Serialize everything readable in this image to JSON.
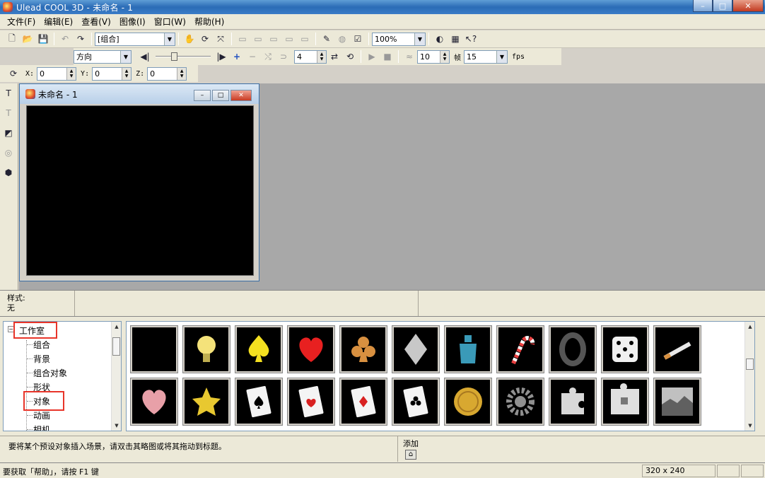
{
  "window": {
    "title": "Ulead COOL 3D - 未命名 - 1",
    "controls": {
      "minimize": "–",
      "maximize": "□",
      "close": "✕"
    }
  },
  "menu": {
    "items": [
      "文件(F)",
      "编辑(E)",
      "查看(V)",
      "图像(I)",
      "窗口(W)",
      "帮助(H)"
    ]
  },
  "toolbar1": {
    "object_combo": "[组合]",
    "zoom_combo": "100%"
  },
  "toolbar2": {
    "direction_combo": "方向",
    "frame_value": "4",
    "frame_count": "10",
    "frame_unit": "帧",
    "fps_value": "15",
    "fps_unit": "fps"
  },
  "toolbar3": {
    "x_label": "X:",
    "x_value": "0",
    "y_label": "Y:",
    "y_value": "0",
    "z_label": "Z:",
    "z_value": "0"
  },
  "document": {
    "title": "未命名 - 1"
  },
  "style_bar": {
    "label": "样式:",
    "value": "无"
  },
  "library": {
    "tree": {
      "root": "工作室",
      "items": [
        "组合",
        "背景",
        "组合对象",
        "形状",
        "对象",
        "动画",
        "相机"
      ],
      "selected": "对象"
    },
    "thumbnails": [
      {
        "name": "crescent-moon-thumb",
        "color": "#e8d848"
      },
      {
        "name": "light-bulb-thumb",
        "color": "#f4e27a"
      },
      {
        "name": "spade-thumb",
        "color": "#f4e020"
      },
      {
        "name": "heart-thumb",
        "color": "#e82020"
      },
      {
        "name": "club-thumb",
        "color": "#d89040"
      },
      {
        "name": "diamond-gem-thumb",
        "color": "#c8c8c8"
      },
      {
        "name": "bottle-thumb",
        "color": "#3a9ab8"
      },
      {
        "name": "candy-cane-thumb",
        "color": "#e84040"
      },
      {
        "name": "tire-thumb",
        "color": "#555555"
      },
      {
        "name": "dice-thumb",
        "color": "#f0f0f0"
      },
      {
        "name": "cigarette-thumb",
        "color": "#e8e8e8"
      },
      {
        "name": "patterned-heart-thumb",
        "color": "#e8a0a8"
      },
      {
        "name": "star-fruit-thumb",
        "color": "#e8c830"
      },
      {
        "name": "ace-of-spades-thumb",
        "color": "#f4f4f4"
      },
      {
        "name": "ace-of-hearts-thumb",
        "color": "#f4f4f4"
      },
      {
        "name": "ace-of-diamonds-thumb",
        "color": "#f4f4f4"
      },
      {
        "name": "ace-of-clubs-thumb",
        "color": "#f4f4f4"
      },
      {
        "name": "coin-thumb",
        "color": "#d8a830"
      },
      {
        "name": "gear-thumb",
        "color": "#909090"
      },
      {
        "name": "puzzle-piece-thumb",
        "color": "#d8d8d8"
      },
      {
        "name": "puzzle-pieces-thumb",
        "color": "#e0e0e0"
      },
      {
        "name": "puzzle-photo-thumb",
        "color": "#c0c0c0"
      }
    ]
  },
  "hint": {
    "text": "要将某个预设对象插入场景，请双击其略图或将其拖动到标题。",
    "add_label": "添加"
  },
  "status": {
    "text": "要获取「帮助」，请按 F1 键",
    "size": "320 x 240"
  },
  "colors": {
    "highlight": "#e8352a",
    "titlebar": "#2b6cb6"
  }
}
